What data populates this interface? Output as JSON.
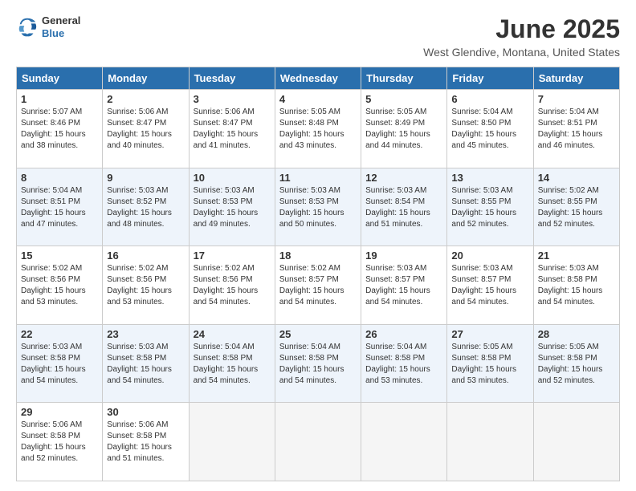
{
  "header": {
    "logo_general": "General",
    "logo_blue": "Blue",
    "title": "June 2025",
    "subtitle": "West Glendive, Montana, United States"
  },
  "calendar": {
    "days_of_week": [
      "Sunday",
      "Monday",
      "Tuesday",
      "Wednesday",
      "Thursday",
      "Friday",
      "Saturday"
    ],
    "weeks": [
      [
        {
          "day": "1",
          "info": "Sunrise: 5:07 AM\nSunset: 8:46 PM\nDaylight: 15 hours\nand 38 minutes."
        },
        {
          "day": "2",
          "info": "Sunrise: 5:06 AM\nSunset: 8:47 PM\nDaylight: 15 hours\nand 40 minutes."
        },
        {
          "day": "3",
          "info": "Sunrise: 5:06 AM\nSunset: 8:47 PM\nDaylight: 15 hours\nand 41 minutes."
        },
        {
          "day": "4",
          "info": "Sunrise: 5:05 AM\nSunset: 8:48 PM\nDaylight: 15 hours\nand 43 minutes."
        },
        {
          "day": "5",
          "info": "Sunrise: 5:05 AM\nSunset: 8:49 PM\nDaylight: 15 hours\nand 44 minutes."
        },
        {
          "day": "6",
          "info": "Sunrise: 5:04 AM\nSunset: 8:50 PM\nDaylight: 15 hours\nand 45 minutes."
        },
        {
          "day": "7",
          "info": "Sunrise: 5:04 AM\nSunset: 8:51 PM\nDaylight: 15 hours\nand 46 minutes."
        }
      ],
      [
        {
          "day": "8",
          "info": "Sunrise: 5:04 AM\nSunset: 8:51 PM\nDaylight: 15 hours\nand 47 minutes."
        },
        {
          "day": "9",
          "info": "Sunrise: 5:03 AM\nSunset: 8:52 PM\nDaylight: 15 hours\nand 48 minutes."
        },
        {
          "day": "10",
          "info": "Sunrise: 5:03 AM\nSunset: 8:53 PM\nDaylight: 15 hours\nand 49 minutes."
        },
        {
          "day": "11",
          "info": "Sunrise: 5:03 AM\nSunset: 8:53 PM\nDaylight: 15 hours\nand 50 minutes."
        },
        {
          "day": "12",
          "info": "Sunrise: 5:03 AM\nSunset: 8:54 PM\nDaylight: 15 hours\nand 51 minutes."
        },
        {
          "day": "13",
          "info": "Sunrise: 5:03 AM\nSunset: 8:55 PM\nDaylight: 15 hours\nand 52 minutes."
        },
        {
          "day": "14",
          "info": "Sunrise: 5:02 AM\nSunset: 8:55 PM\nDaylight: 15 hours\nand 52 minutes."
        }
      ],
      [
        {
          "day": "15",
          "info": "Sunrise: 5:02 AM\nSunset: 8:56 PM\nDaylight: 15 hours\nand 53 minutes."
        },
        {
          "day": "16",
          "info": "Sunrise: 5:02 AM\nSunset: 8:56 PM\nDaylight: 15 hours\nand 53 minutes."
        },
        {
          "day": "17",
          "info": "Sunrise: 5:02 AM\nSunset: 8:56 PM\nDaylight: 15 hours\nand 54 minutes."
        },
        {
          "day": "18",
          "info": "Sunrise: 5:02 AM\nSunset: 8:57 PM\nDaylight: 15 hours\nand 54 minutes."
        },
        {
          "day": "19",
          "info": "Sunrise: 5:03 AM\nSunset: 8:57 PM\nDaylight: 15 hours\nand 54 minutes."
        },
        {
          "day": "20",
          "info": "Sunrise: 5:03 AM\nSunset: 8:57 PM\nDaylight: 15 hours\nand 54 minutes."
        },
        {
          "day": "21",
          "info": "Sunrise: 5:03 AM\nSunset: 8:58 PM\nDaylight: 15 hours\nand 54 minutes."
        }
      ],
      [
        {
          "day": "22",
          "info": "Sunrise: 5:03 AM\nSunset: 8:58 PM\nDaylight: 15 hours\nand 54 minutes."
        },
        {
          "day": "23",
          "info": "Sunrise: 5:03 AM\nSunset: 8:58 PM\nDaylight: 15 hours\nand 54 minutes."
        },
        {
          "day": "24",
          "info": "Sunrise: 5:04 AM\nSunset: 8:58 PM\nDaylight: 15 hours\nand 54 minutes."
        },
        {
          "day": "25",
          "info": "Sunrise: 5:04 AM\nSunset: 8:58 PM\nDaylight: 15 hours\nand 54 minutes."
        },
        {
          "day": "26",
          "info": "Sunrise: 5:04 AM\nSunset: 8:58 PM\nDaylight: 15 hours\nand 53 minutes."
        },
        {
          "day": "27",
          "info": "Sunrise: 5:05 AM\nSunset: 8:58 PM\nDaylight: 15 hours\nand 53 minutes."
        },
        {
          "day": "28",
          "info": "Sunrise: 5:05 AM\nSunset: 8:58 PM\nDaylight: 15 hours\nand 52 minutes."
        }
      ],
      [
        {
          "day": "29",
          "info": "Sunrise: 5:06 AM\nSunset: 8:58 PM\nDaylight: 15 hours\nand 52 minutes."
        },
        {
          "day": "30",
          "info": "Sunrise: 5:06 AM\nSunset: 8:58 PM\nDaylight: 15 hours\nand 51 minutes."
        },
        {
          "day": "",
          "info": ""
        },
        {
          "day": "",
          "info": ""
        },
        {
          "day": "",
          "info": ""
        },
        {
          "day": "",
          "info": ""
        },
        {
          "day": "",
          "info": ""
        }
      ]
    ]
  }
}
